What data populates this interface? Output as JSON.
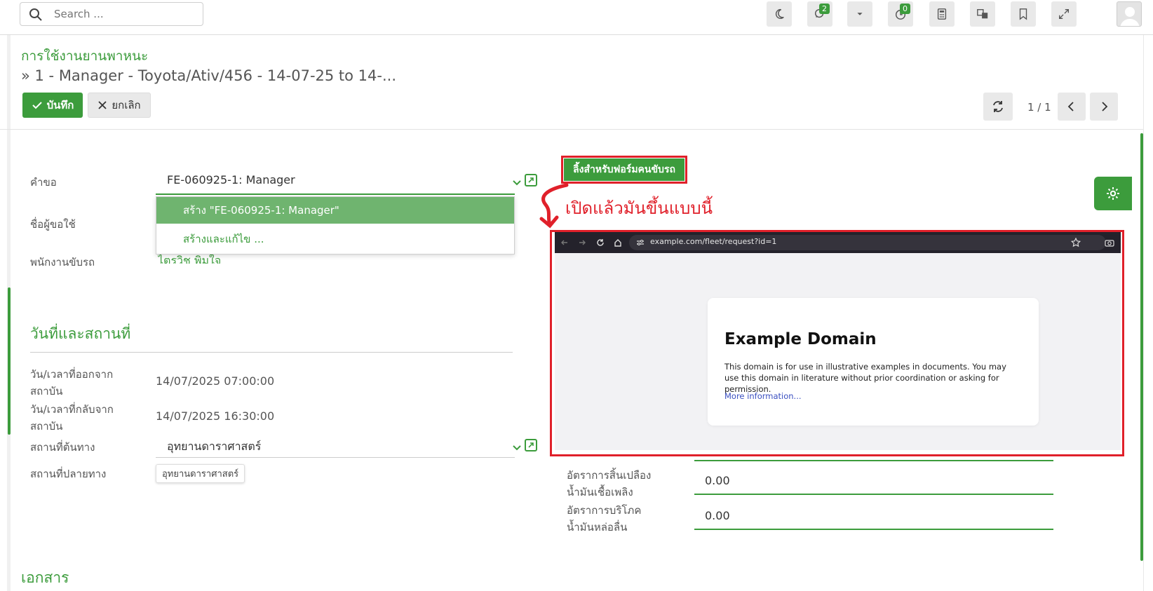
{
  "topbar": {
    "search_placeholder": "Search ...",
    "chat_badge": "2",
    "activity_badge": "0"
  },
  "control": {
    "app_title": "การใช้งานยานพาหนะ",
    "record_title": "» 1 - Manager - Toyota/Ativ/456 - 14-07-25 to 14-...",
    "save_label": "บันทึก",
    "cancel_label": "ยกเลิก",
    "pager": "1 / 1"
  },
  "form": {
    "request_label": "คำขอ",
    "request_value": "FE-060925-1: Manager",
    "requester_label": "ชื่อผู้ขอใช้",
    "driver_label": "พนักงานขับรถ",
    "driver_value": "ไตรวิช พิมใจ",
    "dropdown": {
      "create": "สร้าง \"FE-060925-1: Manager\"",
      "create_edit": "สร้างและแก้ไข ..."
    },
    "section_datetime": "วันที่และสถานที่",
    "depart_label_1": "วัน/เวลาที่ออกจาก",
    "depart_label_2": "สถาบัน",
    "depart_value": "14/07/2025 07:00:00",
    "return_label_1": "วัน/เวลาที่กลับจาก",
    "return_label_2": "สถาบัน",
    "return_value": "14/07/2025 16:30:00",
    "origin_label": "สถานที่ต้นทาง",
    "origin_value": "อุทยานดาราศาสตร์",
    "destination_label": "สถานที่ปลายทาง",
    "destination_chip": "อุทยานดาราศาสตร์",
    "fuel_label_1": "อัตราการสิ้นเปลือง",
    "fuel_label_2": "น้ำมันเชื้อเพลิง",
    "fuel_value": "0.00",
    "lube_label_1": "อัตราการบริโภค",
    "lube_label_2": "น้ำมันหล่อลื่น",
    "lube_value": "0.00",
    "section_docs": "เอกสาร"
  },
  "annotation": {
    "link_button": "ลิ้งสำหรับฟอร์มคนขับรถ",
    "note": "เปิดแล้วมันขึ้นแบบนี้"
  },
  "embedded_browser": {
    "url": "example.com/fleet/request?id=1",
    "heading": "Example Domain",
    "body": "This domain is for use in illustrative examples in documents. You may use this domain in literature without prior coordination or asking for permission.",
    "link": "More information..."
  },
  "colors": {
    "accent": "#3c9c3c",
    "annotation_red": "#e0202a"
  }
}
